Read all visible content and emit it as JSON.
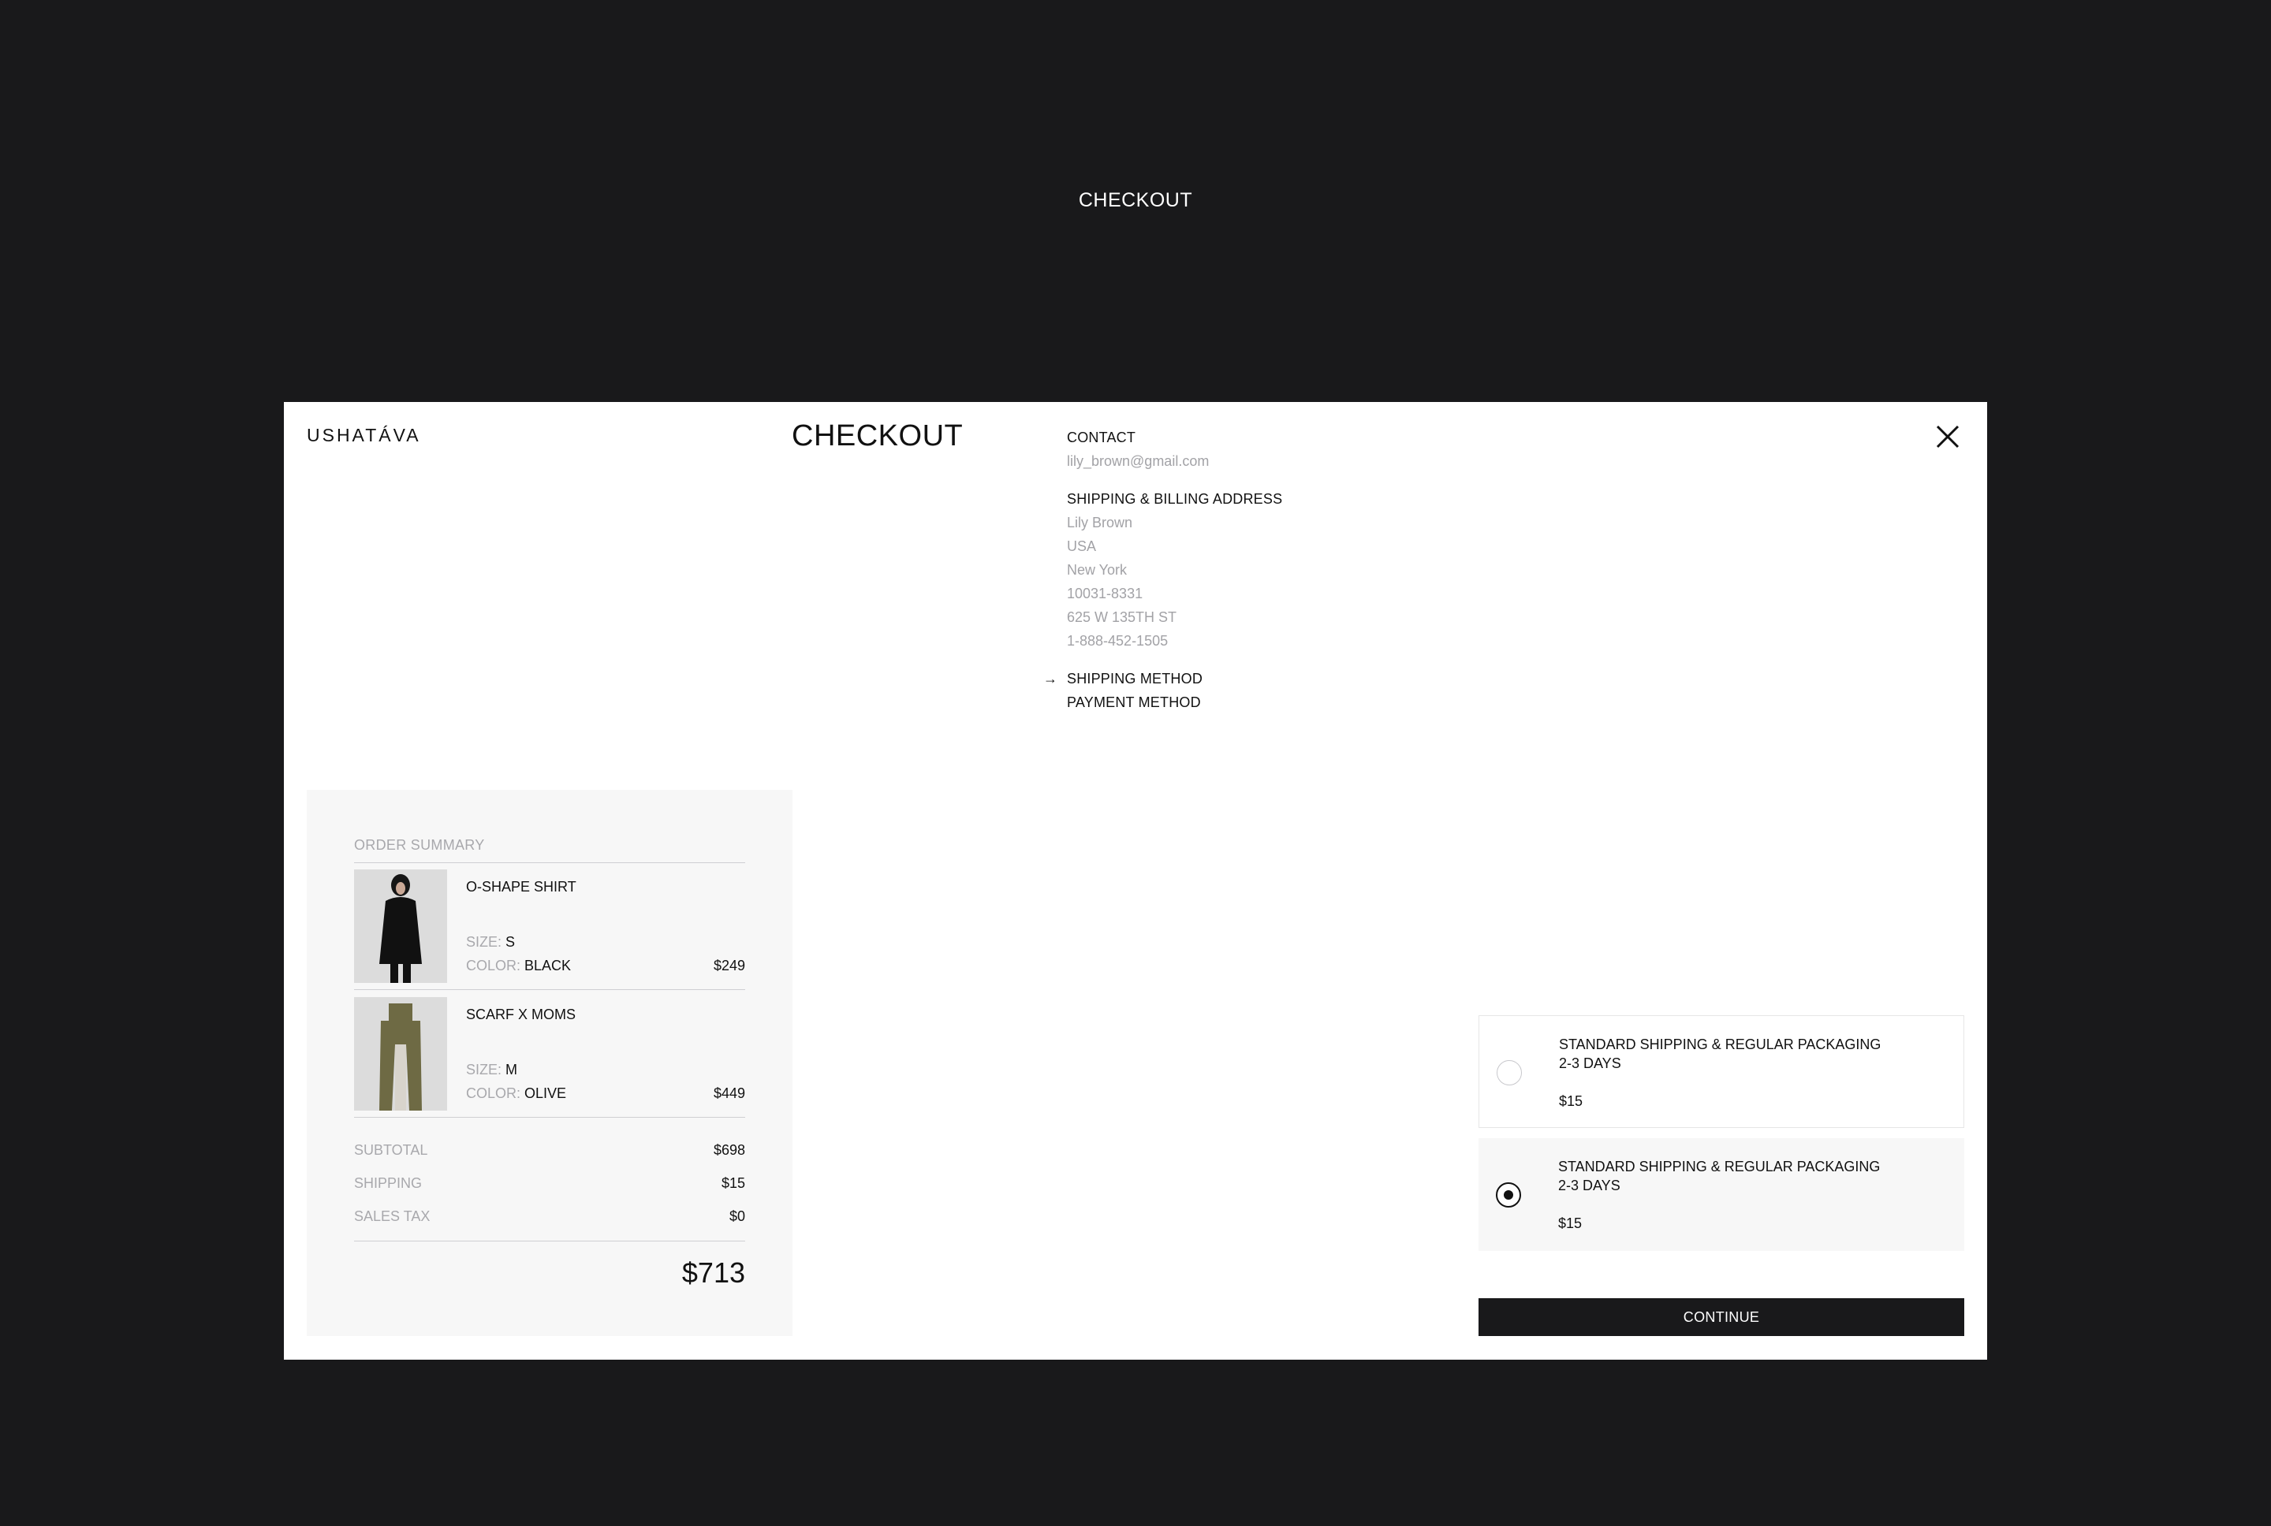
{
  "page": {
    "title": "CHECKOUT"
  },
  "modal": {
    "logo": "USHATÁVA",
    "title": "CHECKOUT",
    "close_icon": "close-icon"
  },
  "steps": {
    "contact_label": "CONTACT",
    "contact_email": "lily_brown@gmail.com",
    "address_label": "SHIPPING & BILLING ADDRESS",
    "address_lines": [
      "Lily Brown",
      "USA",
      "New York",
      "10031-8331",
      "625 W 135TH ST",
      "1-888-452-1505"
    ],
    "active_arrow": "→",
    "shipping_method_label": "SHIPPING METHOD",
    "payment_method_label": "PAYMENT METHOD"
  },
  "summary": {
    "heading": "ORDER SUMMARY",
    "items": [
      {
        "name": "O-SHAPE SHIRT",
        "size_label": "SIZE:",
        "size": "S",
        "color_label": "COLOR:",
        "color": "BLACK",
        "price": "$249",
        "image": "black-shirt-photo"
      },
      {
        "name": "SCARF X MOMS",
        "size_label": "SIZE:",
        "size": "M",
        "color_label": "COLOR:",
        "color": "OLIVE",
        "price": "$449",
        "image": "olive-scarf-photo"
      }
    ],
    "subtotal_label": "SUBTOTAL",
    "subtotal": "$698",
    "shipping_label": "SHIPPING",
    "shipping": "$15",
    "tax_label": "SALES TAX",
    "tax": "$0",
    "total": "$713"
  },
  "shipping_options": [
    {
      "title": "STANDARD SHIPPING & REGULAR PACKAGING",
      "days": "2-3 DAYS",
      "price": "$15",
      "selected": false
    },
    {
      "title": "STANDARD SHIPPING & REGULAR PACKAGING",
      "days": "2-3 DAYS",
      "price": "$15",
      "selected": true
    }
  ],
  "continue_label": "CONTINUE",
  "colors": {
    "backdrop": "#19191b",
    "panel": "#f7f7f7",
    "muted_text": "#a8a8ac",
    "accent": "#111111"
  }
}
